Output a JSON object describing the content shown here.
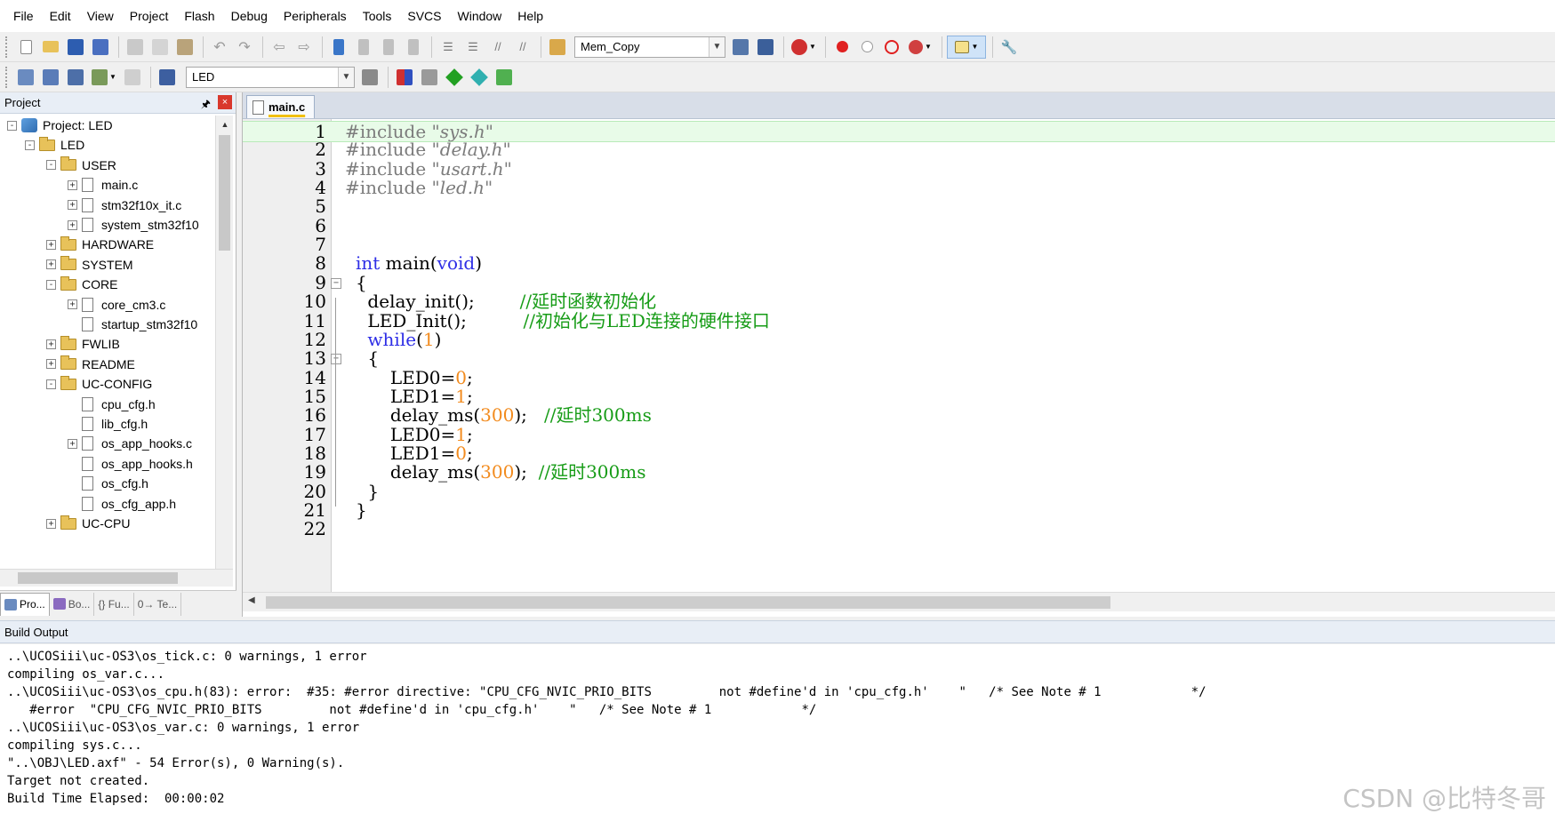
{
  "menu": [
    "File",
    "Edit",
    "View",
    "Project",
    "Flash",
    "Debug",
    "Peripherals",
    "Tools",
    "SVCS",
    "Window",
    "Help"
  ],
  "toolbar1": {
    "find_combo": "Mem_Copy"
  },
  "toolbar2": {
    "target_combo": "LED"
  },
  "project_panel": {
    "title": "Project",
    "pin": "🖈",
    "close": "×",
    "tree": [
      {
        "label": "Project: LED",
        "level": 0,
        "kind": "project",
        "exp": "-"
      },
      {
        "label": "LED",
        "level": 1,
        "kind": "folder",
        "exp": "-"
      },
      {
        "label": "USER",
        "level": 2,
        "kind": "folder",
        "exp": "-"
      },
      {
        "label": "main.c",
        "level": 3,
        "kind": "file",
        "exp": "+"
      },
      {
        "label": "stm32f10x_it.c",
        "level": 3,
        "kind": "file",
        "exp": "+"
      },
      {
        "label": "system_stm32f10",
        "level": 3,
        "kind": "file",
        "exp": "+"
      },
      {
        "label": "HARDWARE",
        "level": 2,
        "kind": "folder",
        "exp": "+"
      },
      {
        "label": "SYSTEM",
        "level": 2,
        "kind": "folder",
        "exp": "+"
      },
      {
        "label": "CORE",
        "level": 2,
        "kind": "folder",
        "exp": "-"
      },
      {
        "label": "core_cm3.c",
        "level": 3,
        "kind": "file",
        "exp": "+"
      },
      {
        "label": "startup_stm32f10",
        "level": 3,
        "kind": "file",
        "exp": ""
      },
      {
        "label": "FWLIB",
        "level": 2,
        "kind": "folder",
        "exp": "+"
      },
      {
        "label": "README",
        "level": 2,
        "kind": "folder",
        "exp": "+"
      },
      {
        "label": "UC-CONFIG",
        "level": 2,
        "kind": "folder",
        "exp": "-"
      },
      {
        "label": "cpu_cfg.h",
        "level": 3,
        "kind": "file",
        "exp": ""
      },
      {
        "label": "lib_cfg.h",
        "level": 3,
        "kind": "file",
        "exp": ""
      },
      {
        "label": "os_app_hooks.c",
        "level": 3,
        "kind": "file",
        "exp": "+"
      },
      {
        "label": "os_app_hooks.h",
        "level": 3,
        "kind": "file",
        "exp": ""
      },
      {
        "label": "os_cfg.h",
        "level": 3,
        "kind": "file",
        "exp": ""
      },
      {
        "label": "os_cfg_app.h",
        "level": 3,
        "kind": "file",
        "exp": ""
      },
      {
        "label": "UC-CPU",
        "level": 2,
        "kind": "folder",
        "exp": "+"
      }
    ],
    "tabs": [
      "Pro...",
      "Bo...",
      "{} Fu...",
      "0→ Te..."
    ]
  },
  "editor": {
    "tab": "main.c",
    "lines": [
      {
        "n": "1"
      },
      {
        "n": "2"
      },
      {
        "n": "3"
      },
      {
        "n": "4"
      },
      {
        "n": "5"
      },
      {
        "n": "6"
      },
      {
        "n": "7"
      },
      {
        "n": "8"
      },
      {
        "n": "9"
      },
      {
        "n": "10"
      },
      {
        "n": "11"
      },
      {
        "n": "12"
      },
      {
        "n": "13"
      },
      {
        "n": "14"
      },
      {
        "n": "15"
      },
      {
        "n": "16"
      },
      {
        "n": "17"
      },
      {
        "n": "18"
      },
      {
        "n": "19"
      },
      {
        "n": "20"
      },
      {
        "n": "21"
      },
      {
        "n": "22"
      }
    ],
    "code": {
      "l1_pp": "#include ",
      "l1_str": "\"sys.h\"",
      "l2_pp": "#include ",
      "l2_str": "\"delay.h\"",
      "l3_pp": "#include ",
      "l3_str": "\"usart.h\"",
      "l4_pp": "#include ",
      "l4_str": "\"led.h\"",
      "l8_kw": "int",
      "l8_a": " main",
      "l8_b": "(",
      "l8_kw2": "void",
      "l8_c": ")",
      "l9": "{",
      "l10_a": "    delay_init();        ",
      "l10_cm": "//延时函数初始化",
      "l11_a": "    LED_Init();          ",
      "l11_cm": "//初始化与LED连接的硬件接口",
      "l12_kw": "    while",
      "l12_a": "(",
      "l12_num": "1",
      "l12_b": ")",
      "l13": "    {",
      "l14_a": "        LED0=",
      "l14_num": "0",
      "l14_b": ";",
      "l15_a": "        LED1=",
      "l15_num": "1",
      "l15_b": ";",
      "l16_a": "        delay_ms(",
      "l16_num": "300",
      "l16_b": ");   ",
      "l16_cm": "//延时300ms",
      "l17_a": "        LED0=",
      "l17_num": "1",
      "l17_b": ";",
      "l18_a": "        LED1=",
      "l18_num": "0",
      "l18_b": ";",
      "l19_a": "        delay_ms(",
      "l19_num": "300",
      "l19_b": ");  ",
      "l19_cm": "//延时300ms",
      "l20": "    }",
      "l21": "}"
    }
  },
  "build_output": {
    "title": "Build Output",
    "lines": [
      "..\\UCOSiii\\uc-OS3\\os_tick.c: 0 warnings, 1 error",
      "compiling os_var.c...",
      "..\\UCOSiii\\uc-OS3\\os_cpu.h(83): error:  #35: #error directive: \"CPU_CFG_NVIC_PRIO_BITS         not #define'd in 'cpu_cfg.h'    \"   /* See Note # 1            */",
      "   #error  \"CPU_CFG_NVIC_PRIO_BITS         not #define'd in 'cpu_cfg.h'    \"   /* See Note # 1            */",
      "..\\UCOSiii\\uc-OS3\\os_var.c: 0 warnings, 1 error",
      "compiling sys.c...",
      "\"..\\OBJ\\LED.axf\" - 54 Error(s), 0 Warning(s).",
      "Target not created.",
      "Build Time Elapsed:  00:00:02"
    ]
  },
  "watermark": "CSDN @比特冬哥",
  "colors": {
    "keyword": "#2e2ee6",
    "number": "#f28b1e",
    "comment": "#179c17",
    "preprocessor": "#7c7c7c",
    "current_line": "#e8fbe8"
  }
}
